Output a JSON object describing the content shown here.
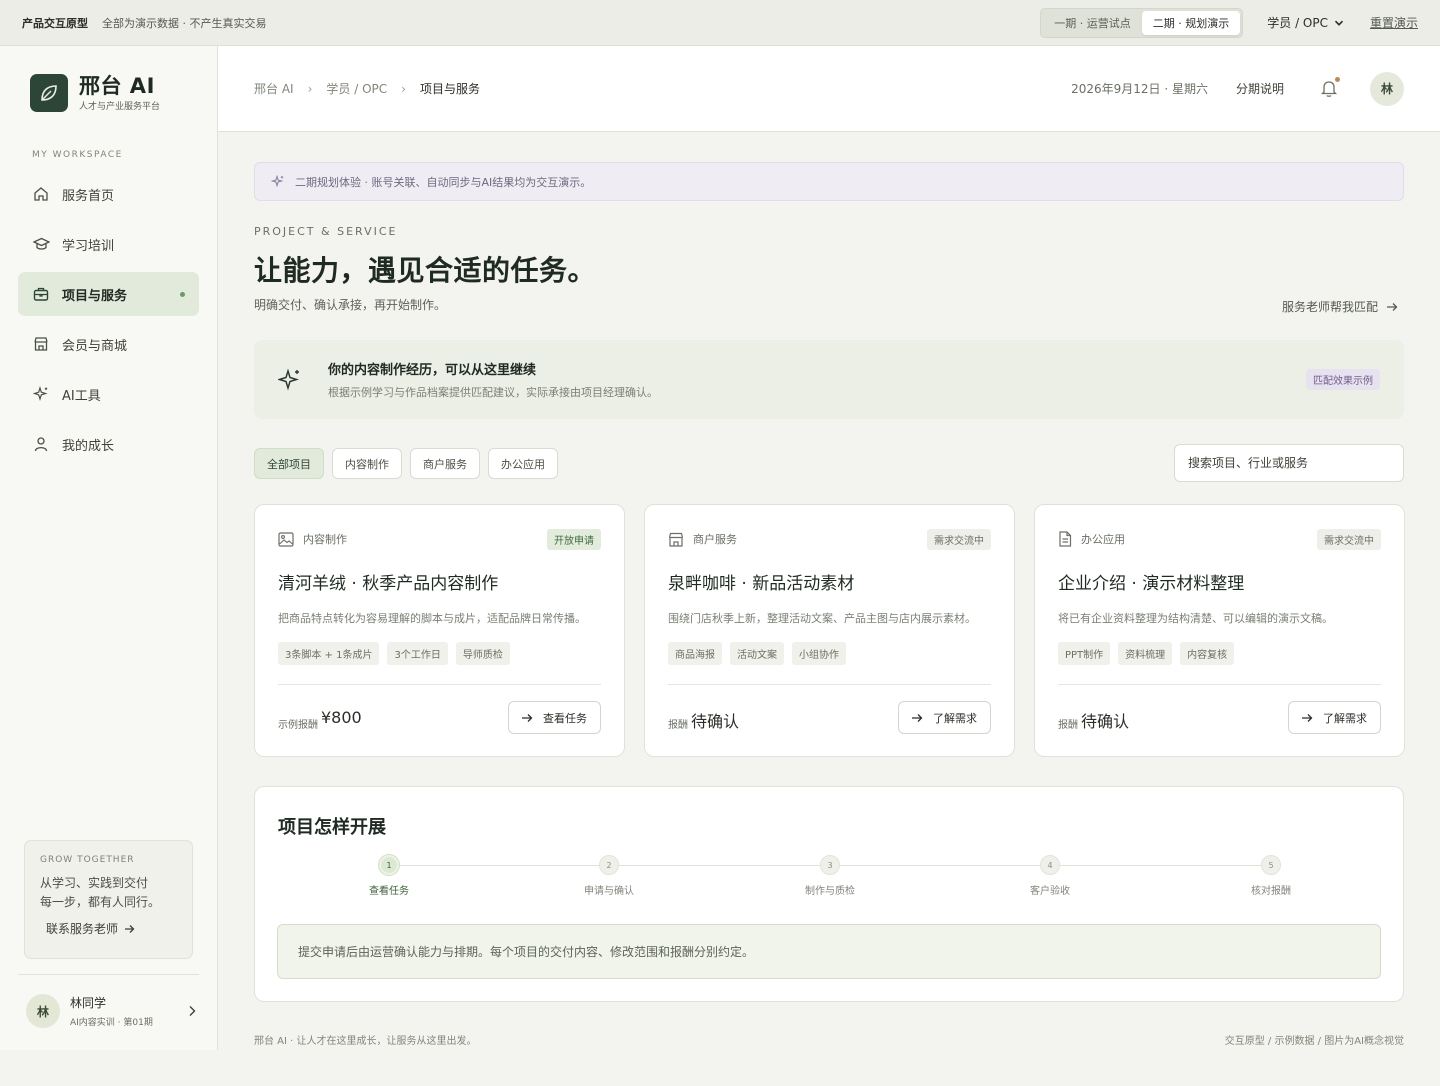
{
  "topbar": {
    "brand": "产品交互原型",
    "note": "全部为演示数据 · 不产生真实交易",
    "phase_tabs": [
      {
        "label": "一期 · 运营试点",
        "active": false
      },
      {
        "label": "二期 · 规划演示",
        "active": true
      }
    ],
    "role": "学员 / OPC",
    "reset": "重置演示"
  },
  "sidebar": {
    "logo_title": "邢台 AI",
    "logo_sub": "人才与产业服务平台",
    "workspace_label": "MY WORKSPACE",
    "items": [
      {
        "label": "服务首页",
        "icon": "home-icon"
      },
      {
        "label": "学习培训",
        "icon": "graduation-cap-icon"
      },
      {
        "label": "项目与服务",
        "icon": "briefcase-icon",
        "active": true
      },
      {
        "label": "会员与商城",
        "icon": "store-icon"
      },
      {
        "label": "AI工具",
        "icon": "sparkle-icon"
      },
      {
        "label": "我的成长",
        "icon": "user-icon"
      }
    ],
    "grow": {
      "label": "GROW TOGETHER",
      "line1": "从学习、实践到交付",
      "line2": "每一步，都有人同行。",
      "link": "联系服务老师"
    },
    "user": {
      "avatar": "林",
      "name": "林同学",
      "sub": "AI内容实训 · 第01期"
    }
  },
  "header": {
    "breadcrumb": [
      "邢台 AI",
      "学员 / OPC",
      "项目与服务"
    ],
    "date": "2026年9月12日 · 星期六",
    "installment": "分期说明",
    "avatar": "林"
  },
  "main": {
    "notice": "二期规划体验 · 账号关联、自动同步与AI结果均为交互演示。",
    "eyebrow": "PROJECT & SERVICE",
    "title": "让能力，遇见合适的任务。",
    "subtitle": "明确交付、确认承接，再开始制作。",
    "match_link": "服务老师帮我匹配",
    "continue_card": {
      "title": "你的内容制作经历，可以从这里继续",
      "sub": "根据示例学习与作品档案提供匹配建议，实际承接由项目经理确认。",
      "badge": "匹配效果示例"
    },
    "filters": [
      {
        "label": "全部项目",
        "active": true
      },
      {
        "label": "内容制作",
        "active": false
      },
      {
        "label": "商户服务",
        "active": false
      },
      {
        "label": "办公应用",
        "active": false
      }
    ],
    "search_placeholder": "搜索项目、行业或服务",
    "cards": [
      {
        "category": "内容制作",
        "icon": "image-icon",
        "badge": "开放申请",
        "badge_type": "open",
        "title": "清河羊绒 · 秋季产品内容制作",
        "desc": "把商品特点转化为容易理解的脚本与成片，适配品牌日常传播。",
        "tags": [
          "3条脚本 + 1条成片",
          "3个工作日",
          "导师质检"
        ],
        "price_label": "示例报酬",
        "price": "¥800",
        "button": "查看任务"
      },
      {
        "category": "商户服务",
        "icon": "store-icon",
        "badge": "需求交流中",
        "badge_type": "comm",
        "title": "泉畔咖啡 · 新品活动素材",
        "desc": "围绕门店秋季上新，整理活动文案、产品主图与店内展示素材。",
        "tags": [
          "商品海报",
          "活动文案",
          "小组协作"
        ],
        "price_label": "报酬",
        "price": "待确认",
        "button": "了解需求"
      },
      {
        "category": "办公应用",
        "icon": "document-icon",
        "badge": "需求交流中",
        "badge_type": "comm",
        "title": "企业介绍 · 演示材料整理",
        "desc": "将已有企业资料整理为结构清楚、可以编辑的演示文稿。",
        "tags": [
          "PPT制作",
          "资料梳理",
          "内容复核"
        ],
        "price_label": "报酬",
        "price": "待确认",
        "button": "了解需求"
      }
    ],
    "process": {
      "title": "项目怎样开展",
      "steps": [
        {
          "num": "1",
          "label": "查看任务",
          "active": true
        },
        {
          "num": "2",
          "label": "申请与确认",
          "active": false
        },
        {
          "num": "3",
          "label": "制作与质检",
          "active": false
        },
        {
          "num": "4",
          "label": "客户验收",
          "active": false
        },
        {
          "num": "5",
          "label": "核对报酬",
          "active": false
        }
      ],
      "note": "提交申请后由运营确认能力与排期。每个项目的交付内容、修改范围和报酬分别约定。"
    }
  },
  "footer": {
    "left": "邢台 AI · 让人才在这里成长，让服务从这里出发。",
    "right": "交互原型 / 示例数据 / 图片为AI概念视觉"
  }
}
